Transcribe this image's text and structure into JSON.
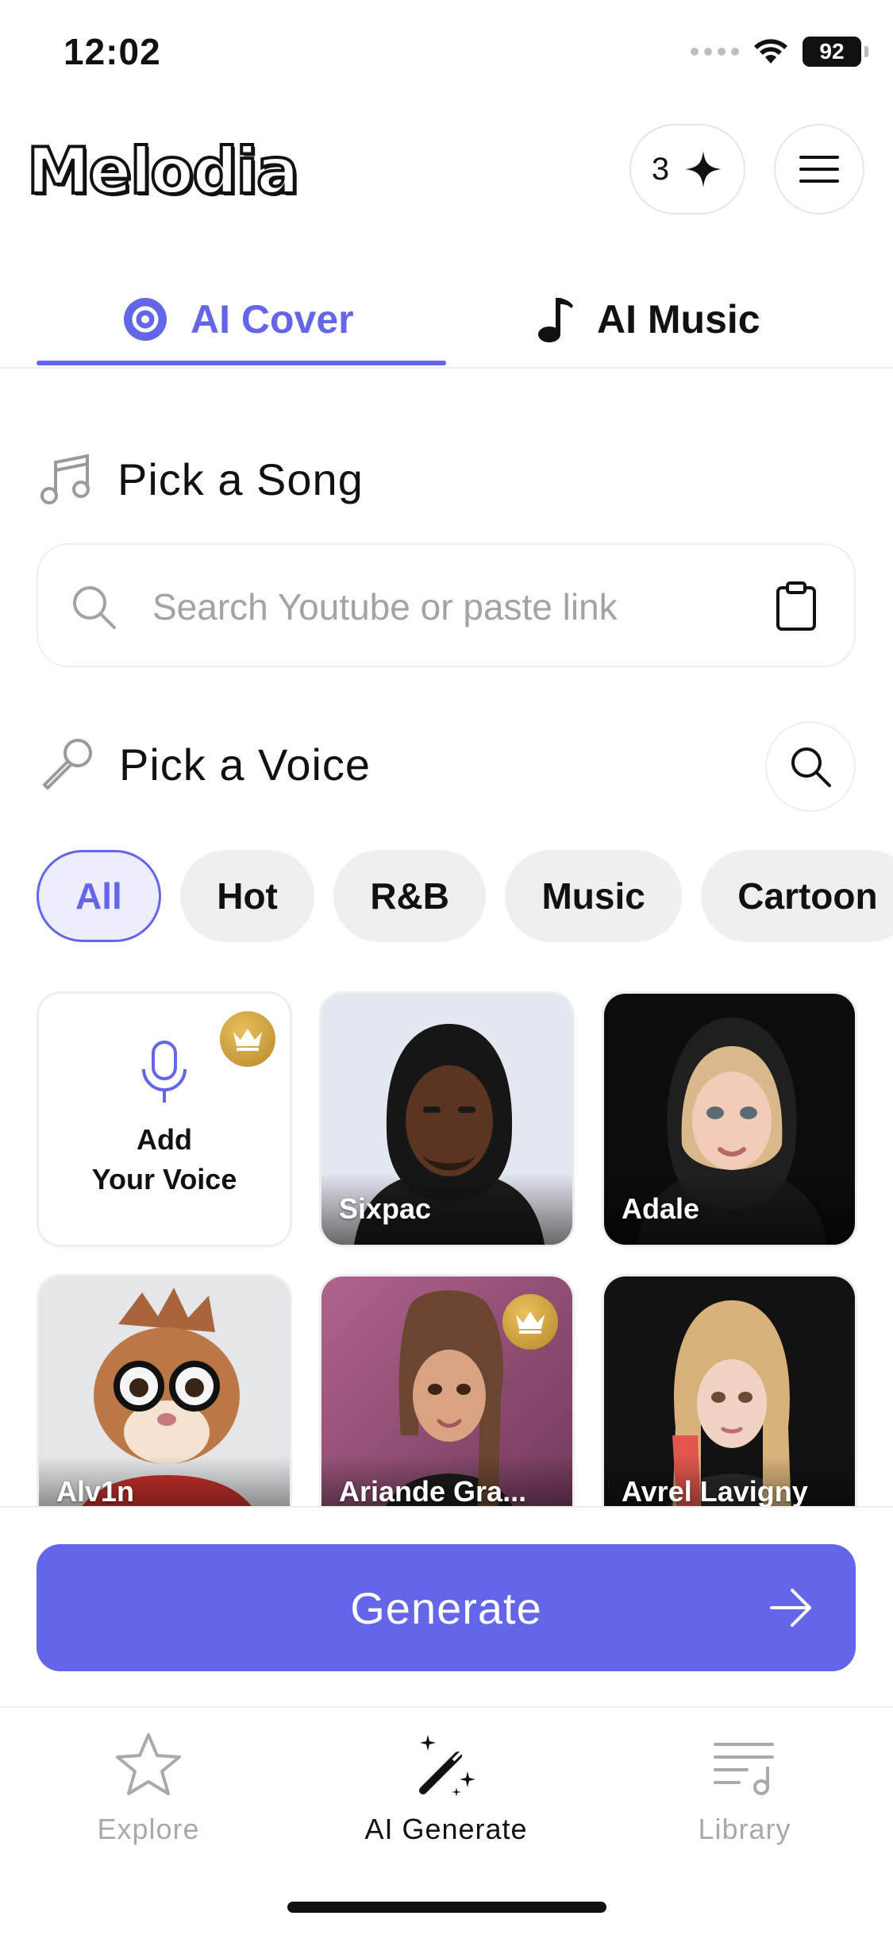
{
  "status_bar": {
    "time": "12:02",
    "battery": "92"
  },
  "header": {
    "logo": "Melodia",
    "credits": "3"
  },
  "tabs": [
    {
      "label": "AI Cover",
      "icon": "disc-icon",
      "active": true
    },
    {
      "label": "AI Music",
      "icon": "music-note-icon",
      "active": false
    }
  ],
  "song_section": {
    "title": "Pick a Song",
    "search_placeholder": "Search Youtube or paste link",
    "search_value": ""
  },
  "voice_section": {
    "title": "Pick a Voice",
    "chips": [
      "All",
      "Hot",
      "R&B",
      "Music",
      "Cartoon"
    ],
    "active_chip": "All",
    "add_voice": {
      "line1": "Add",
      "line2": "Your Voice"
    },
    "voices": [
      {
        "name": "Sixpac",
        "premium": false
      },
      {
        "name": "Adale",
        "premium": false
      },
      {
        "name": "Alv1n",
        "premium": false
      },
      {
        "name": "Ariande Gra...",
        "premium": true
      },
      {
        "name": "Avrel Lavigny",
        "premium": false
      }
    ]
  },
  "generate_button": {
    "label": "Generate"
  },
  "bottom_nav": [
    {
      "label": "Explore",
      "icon": "star-icon",
      "active": false
    },
    {
      "label": "AI Generate",
      "icon": "magic-wand-icon",
      "active": true
    },
    {
      "label": "Library",
      "icon": "playlist-icon",
      "active": false
    }
  ],
  "colors": {
    "accent": "#6366e8",
    "gold": "#c9a040",
    "chip_bg": "#efeff2",
    "muted": "#a9a9a9"
  }
}
